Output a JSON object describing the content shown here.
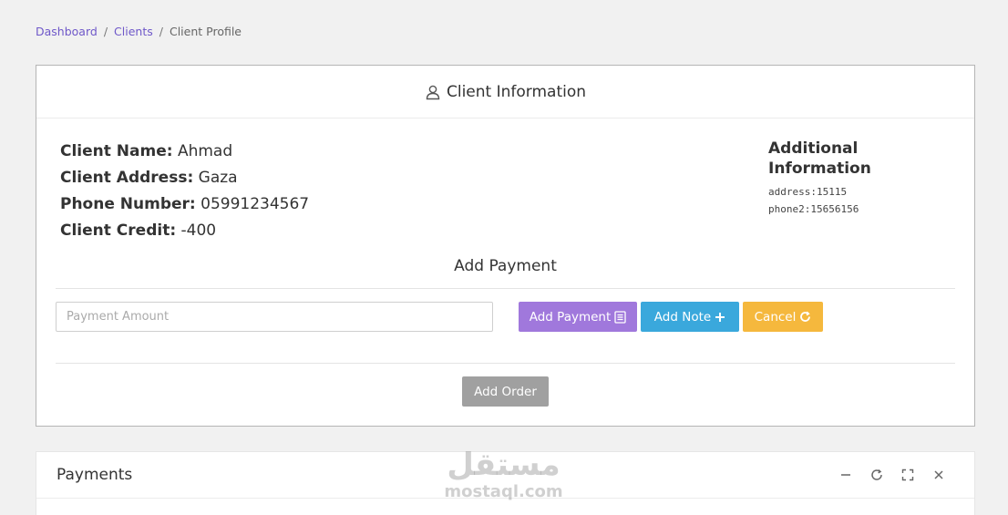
{
  "breadcrumb": {
    "items": [
      "Dashboard",
      "Clients"
    ],
    "separator": "/",
    "current": "Client Profile"
  },
  "client_card": {
    "title": "Client Information",
    "title_icon": "user-icon",
    "fields": [
      {
        "label": "Client Name:",
        "value": "Ahmad"
      },
      {
        "label": "Client Address:",
        "value": "Gaza"
      },
      {
        "label": "Phone Number:",
        "value": "05991234567"
      },
      {
        "label": "Client Credit:",
        "value": "-400"
      }
    ],
    "additional": {
      "title": "Additional Information",
      "lines": [
        "address:15115",
        "phone2:15656156"
      ]
    },
    "payment": {
      "title": "Add Payment",
      "input_placeholder": "Payment Amount",
      "input_value": "",
      "add_payment_label": "Add Payment",
      "add_note_label": "Add Note",
      "cancel_label": "Cancel",
      "add_order_label": "Add Order"
    }
  },
  "payments_card": {
    "title": "Payments",
    "tool_icons": [
      "minimize-icon",
      "refresh-icon",
      "fullscreen-icon",
      "close-icon"
    ]
  },
  "watermark": {
    "arabic": "مستقل",
    "latin": "mostaql.com"
  },
  "colors": {
    "background": "#f1f1f1",
    "link": "#6f58c9",
    "add_payment": "#a078dc",
    "add_note": "#3aa8dc",
    "cancel": "#f5b83d",
    "add_order": "#a0a0a0"
  }
}
